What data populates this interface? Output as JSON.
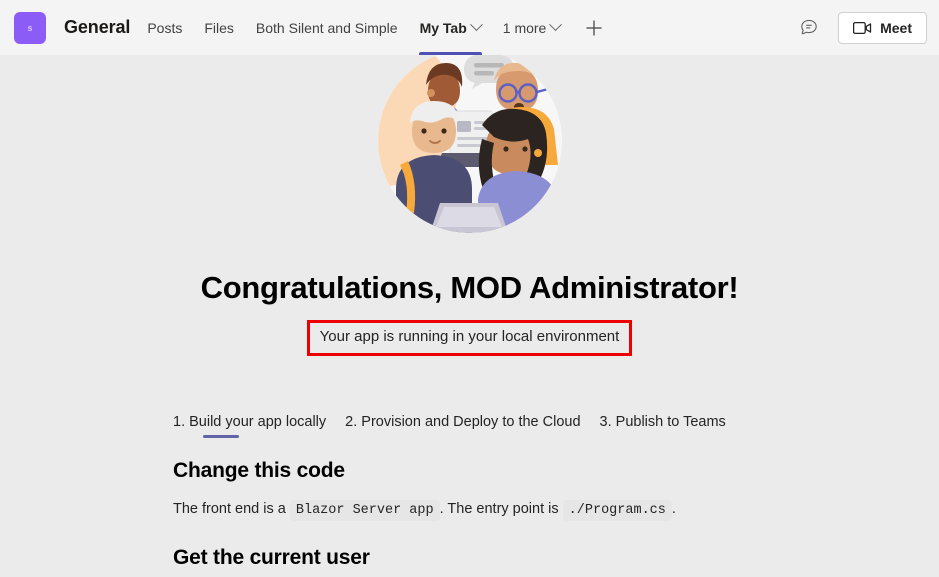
{
  "header": {
    "team_avatar_initial": "s",
    "channel_title": "General",
    "tabs": [
      {
        "label": "Posts",
        "has_chevron": false,
        "active": false
      },
      {
        "label": "Files",
        "has_chevron": false,
        "active": false
      },
      {
        "label": "Both Silent and Simple",
        "has_chevron": false,
        "active": false
      },
      {
        "label": "My Tab",
        "has_chevron": true,
        "active": true
      },
      {
        "label": "1 more",
        "has_chevron": true,
        "active": false
      }
    ],
    "add_tab_label": "+",
    "chat_icon": "chat-bubble-icon",
    "meet": {
      "label": "Meet",
      "icon": "video-camera-icon"
    }
  },
  "main": {
    "illustration": "people-collaborating-illustration",
    "headline": "Congratulations, MOD Administrator!",
    "status_message": "Your app is running in your local environment",
    "status_border_color": "#ee0000",
    "steps": [
      {
        "label": "1. Build your app locally",
        "active": true
      },
      {
        "label": "2. Provision and Deploy to the Cloud",
        "active": false
      },
      {
        "label": "3. Publish to Teams",
        "active": false
      }
    ],
    "sections": [
      {
        "heading": "Change this code",
        "text_before": "The front end is a",
        "code_1": "Blazor Server app",
        "text_middle": ". The entry point is",
        "code_2": "./Program.cs",
        "text_after": "."
      },
      {
        "heading": "Get the current user"
      }
    ]
  },
  "colors": {
    "accent_purple": "#6264a7",
    "tab_underline": "#4f52b2",
    "avatar": "#8b5cf6",
    "header_bg": "#f4f4f4",
    "body_bg": "#ebebeb"
  }
}
